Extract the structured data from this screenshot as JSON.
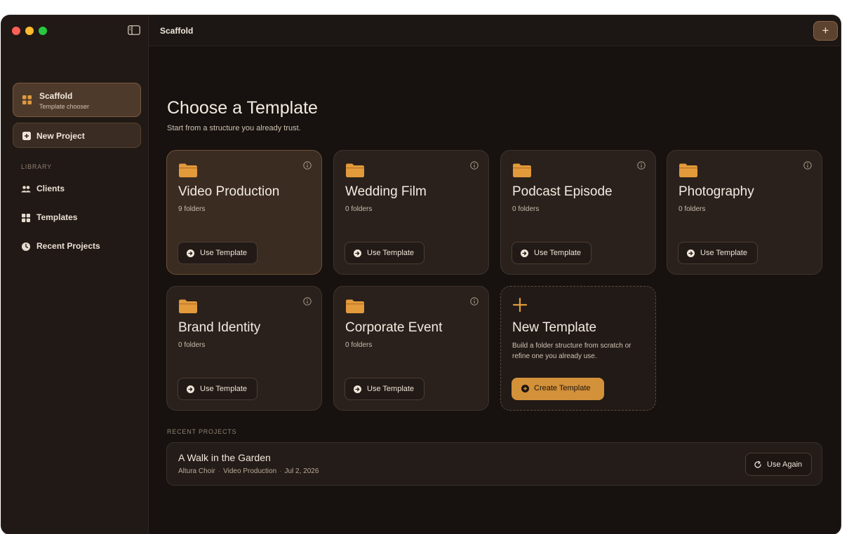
{
  "app": {
    "title": "Scaffold"
  },
  "sidebar": {
    "brand": {
      "title": "Scaffold",
      "subtitle": "Template chooser",
      "icon": "grid-icon"
    },
    "new_project": {
      "label": "New Project",
      "icon": "plus-square-icon"
    },
    "library_label": "LIBRARY",
    "items": [
      {
        "label": "Clients",
        "icon": "people-icon"
      },
      {
        "label": "Templates",
        "icon": "grid-icon"
      },
      {
        "label": "Recent Projects",
        "icon": "clock-icon"
      }
    ]
  },
  "topbar": {
    "title": "Scaffold",
    "add_label": "+"
  },
  "main": {
    "title": "Choose a Template",
    "subtitle": "Start from a structure you already trust.",
    "templates": [
      {
        "title": "Video Production",
        "count": "9 folders",
        "button": "Use Template"
      },
      {
        "title": "Wedding Film",
        "count": "0 folders",
        "button": "Use Template"
      },
      {
        "title": "Podcast Episode",
        "count": "0 folders",
        "button": "Use Template"
      },
      {
        "title": "Photography",
        "count": "0 folders",
        "button": "Use Template"
      },
      {
        "title": "Brand Identity",
        "count": "0 folders",
        "button": "Use Template"
      },
      {
        "title": "Corporate Event",
        "count": "0 folders",
        "button": "Use Template"
      }
    ],
    "new_template": {
      "title": "New Template",
      "description": "Build a folder structure from scratch or refine one you already use.",
      "button": "Create Template"
    },
    "recent_label": "RECENT PROJECTS",
    "recent": [
      {
        "title": "A Walk in the Garden",
        "client": "Altura Choir",
        "template": "Video Production",
        "date": "Jul 2, 2026",
        "button": "Use Again"
      }
    ]
  },
  "colors": {
    "accent": "#d3913a",
    "background": "#17120f",
    "sidebar": "#211915",
    "card": "#2a211c"
  }
}
